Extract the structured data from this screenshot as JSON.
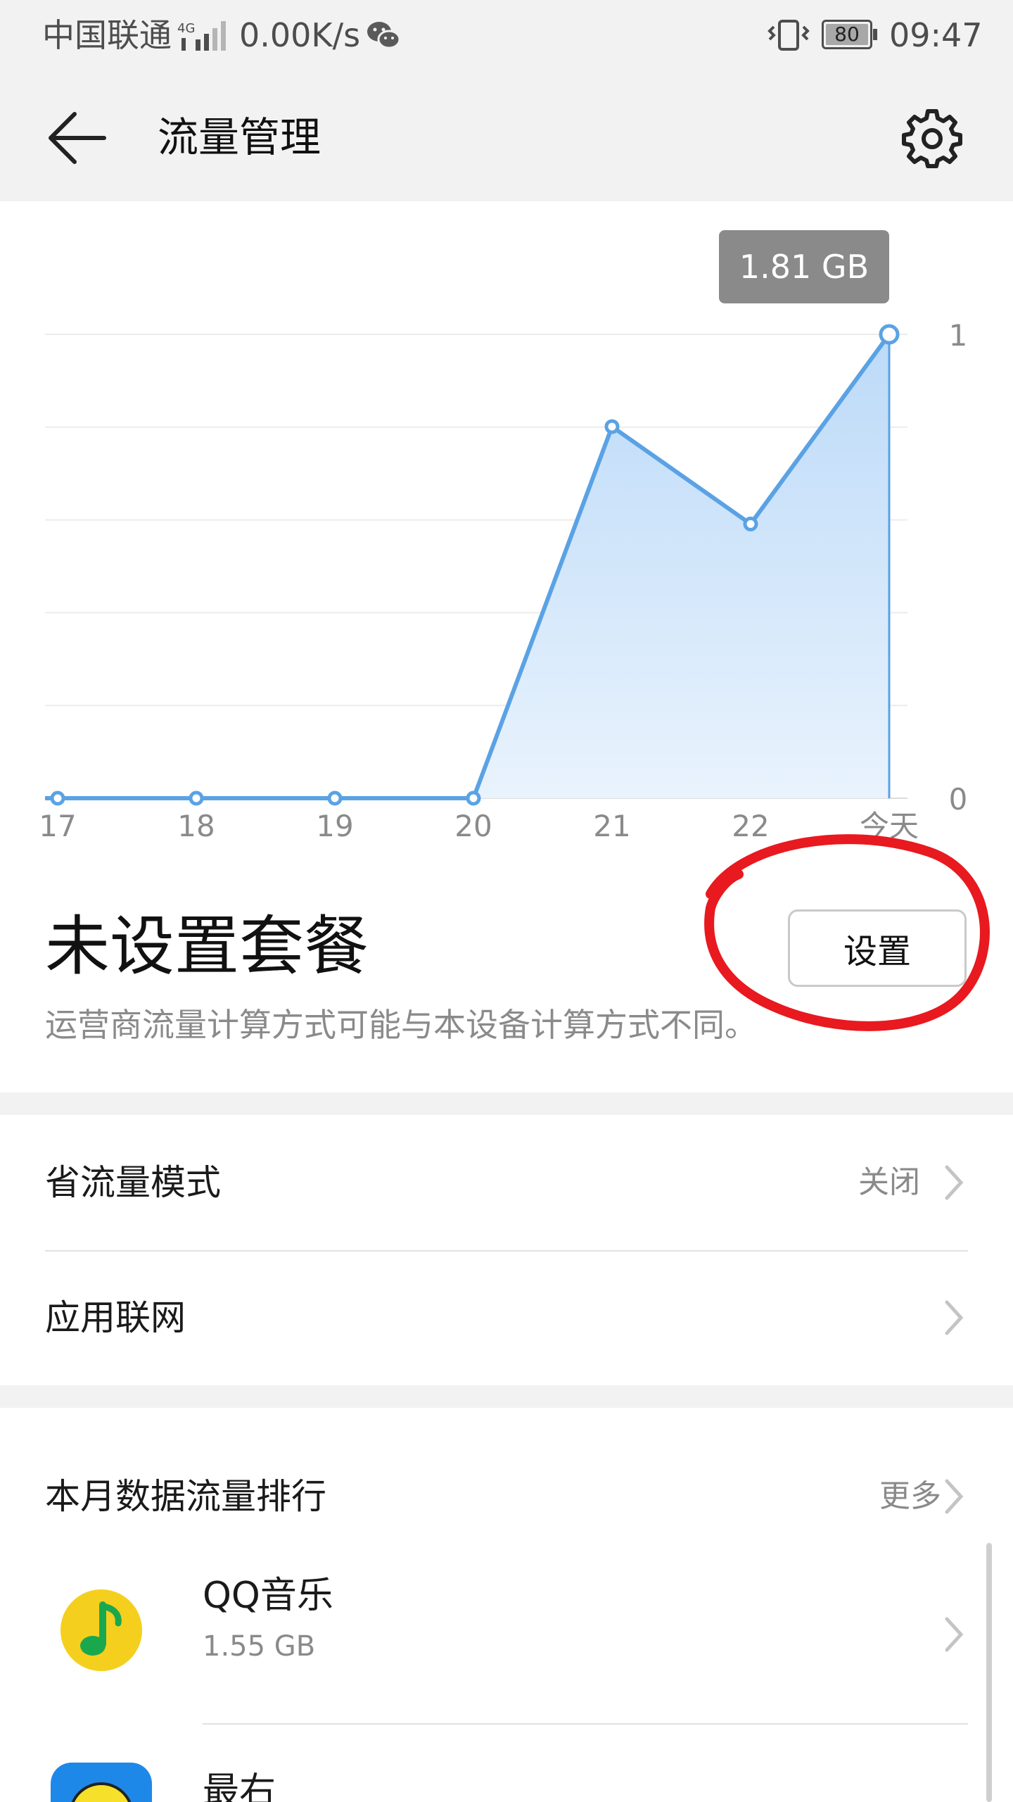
{
  "status_bar": {
    "carrier": "中国联通",
    "network": "4G",
    "speed": "0.00K/s",
    "battery": "80",
    "time": "09:47"
  },
  "header": {
    "title": "流量管理"
  },
  "chart_data": {
    "type": "area",
    "x": [
      "17",
      "18",
      "19",
      "20",
      "21",
      "22",
      "今天"
    ],
    "y_tick_labels": [
      "0",
      "1"
    ],
    "tooltip": "1.81 GB",
    "grid": true,
    "series": [
      {
        "values": [
          0,
          0,
          0,
          0,
          1.45,
          1.07,
          1.81
        ]
      }
    ],
    "color": "#5aa2e4"
  },
  "plan": {
    "title": "未设置套餐",
    "note": "运营商流量计算方式可能与本设备计算方式不同。",
    "setup_button": "设置"
  },
  "settings": {
    "saver_label": "省流量模式",
    "saver_value": "关闭",
    "app_network_label": "应用联网"
  },
  "ranking": {
    "title": "本月数据流量排行",
    "more": "更多",
    "apps": [
      {
        "name": "QQ音乐",
        "size": "1.55 GB",
        "icon": "qq-music-icon"
      },
      {
        "name": "最右",
        "size": "",
        "icon": "zuiyou-icon"
      }
    ]
  },
  "colors": {
    "accent": "#5aa2e4",
    "annotation": "#e8191f",
    "background_band": "#f2f2f2"
  }
}
